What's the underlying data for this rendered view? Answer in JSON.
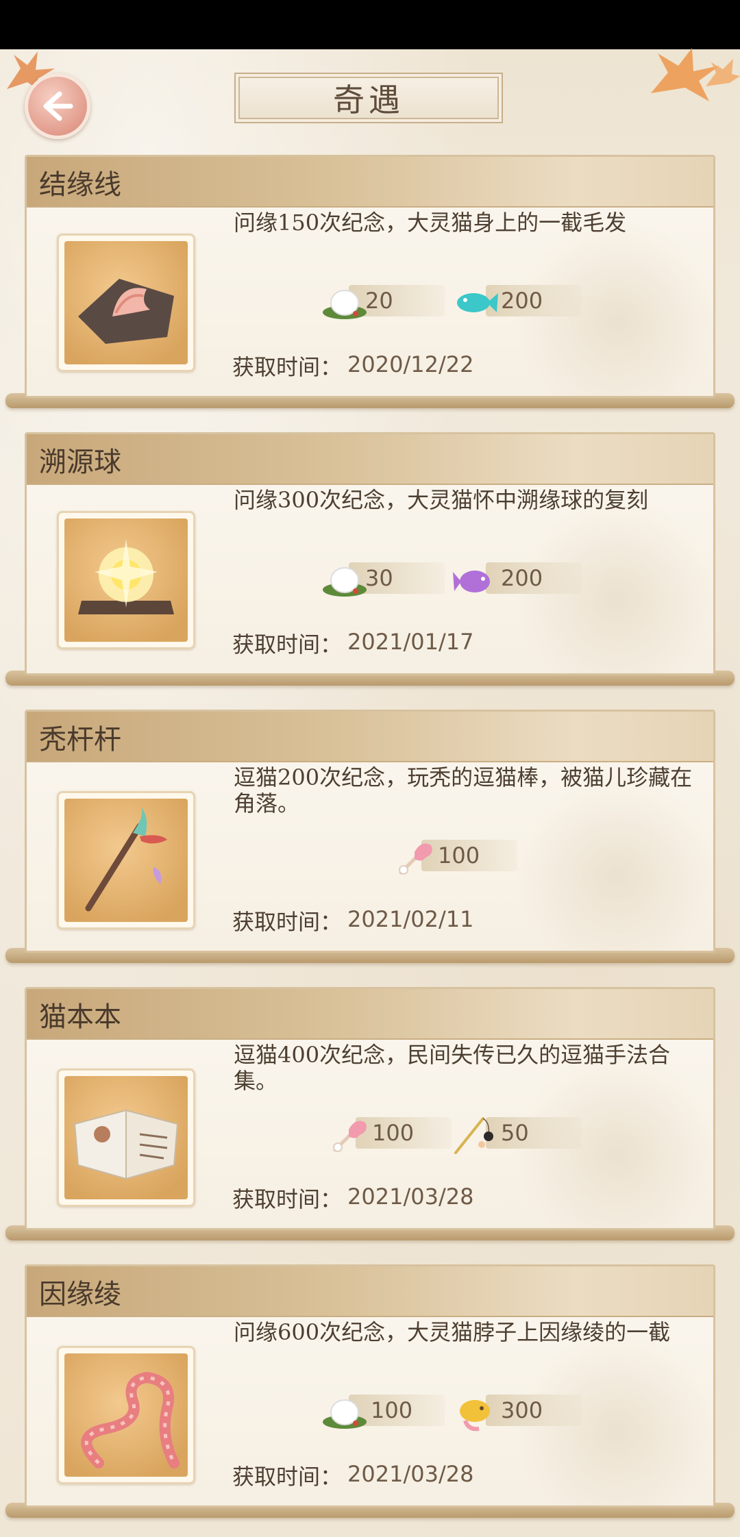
{
  "header": {
    "title": "奇遇",
    "back_icon": "back-arrow-icon"
  },
  "date_label": "获取时间：",
  "cards": [
    {
      "name": "结缘线",
      "description": "问缘150次纪念，大灵猫身上的一截毛发",
      "item_icon": "fur-tuft-icon",
      "rewards": [
        {
          "icon": "bun-on-leaf-icon",
          "value": "20"
        },
        {
          "icon": "cyan-fish-icon",
          "value": "200"
        }
      ],
      "date": "2020/12/22"
    },
    {
      "name": "溯源球",
      "description": "问缘300次纪念，大灵猫怀中溯缘球的复刻",
      "item_icon": "glowing-orb-icon",
      "rewards": [
        {
          "icon": "bun-on-leaf-icon",
          "value": "30"
        },
        {
          "icon": "purple-fish-icon",
          "value": "200"
        }
      ],
      "date": "2021/01/17"
    },
    {
      "name": "秃杆杆",
      "description": "逗猫200次纪念，玩秃的逗猫棒，被猫儿珍藏在角落。",
      "item_icon": "cat-teaser-stick-icon",
      "rewards": [
        {
          "icon": "pink-teaser-icon",
          "value": "100"
        }
      ],
      "date": "2021/02/11"
    },
    {
      "name": "猫本本",
      "description": "逗猫400次纪念，民间失传已久的逗猫手法合集。",
      "item_icon": "open-book-icon",
      "rewards": [
        {
          "icon": "pink-teaser-icon",
          "value": "100"
        },
        {
          "icon": "fishing-rod-teaser-icon",
          "value": "50"
        }
      ],
      "date": "2021/03/28"
    },
    {
      "name": "因缘绫",
      "description": "问缘600次纪念，大灵猫脖子上因缘绫的一截",
      "item_icon": "pink-ribbon-icon",
      "rewards": [
        {
          "icon": "bun-on-leaf-icon",
          "value": "100"
        },
        {
          "icon": "golden-fish-icon",
          "value": "300"
        }
      ],
      "date": "2021/03/28"
    }
  ]
}
